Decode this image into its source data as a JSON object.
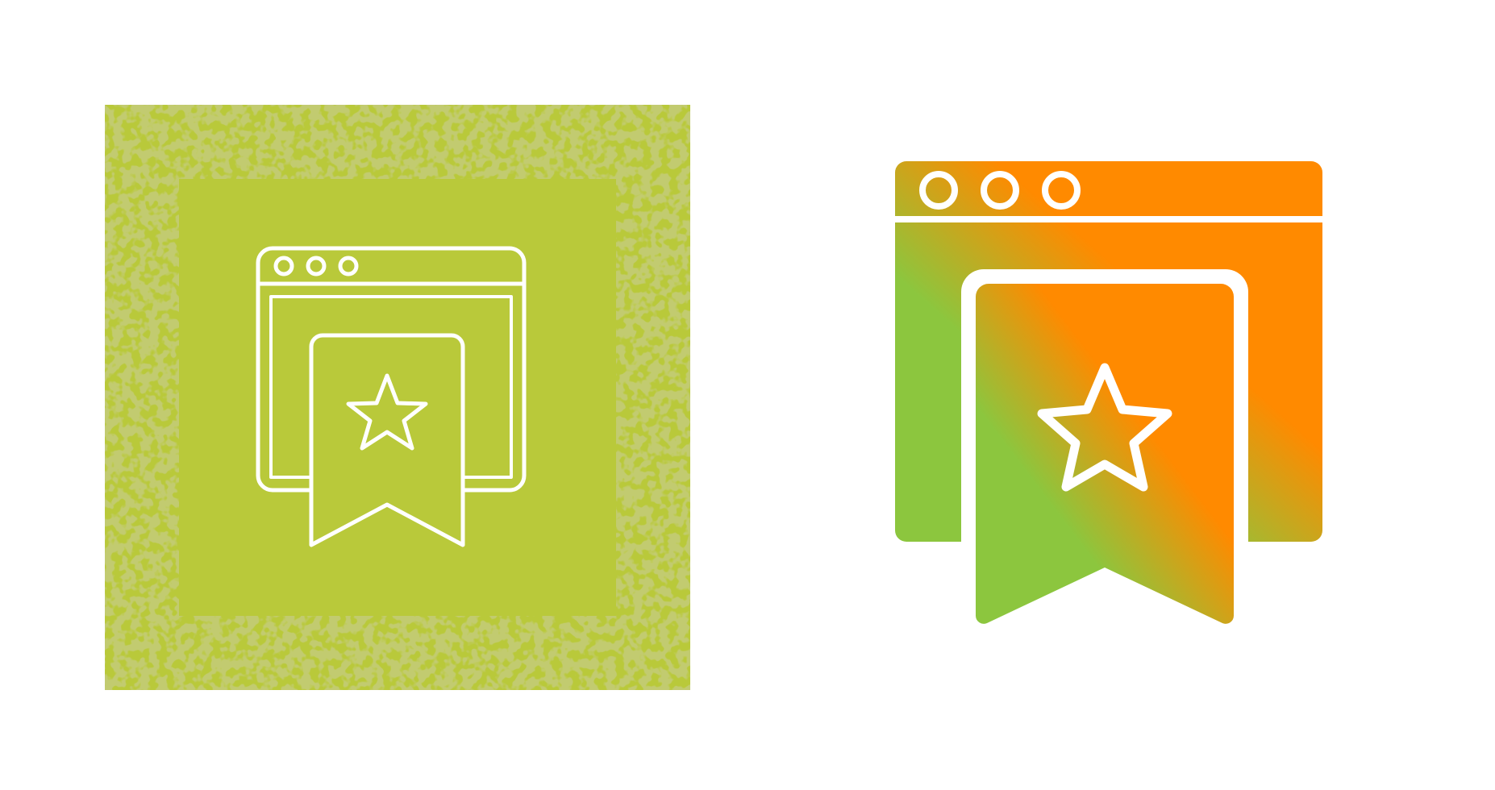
{
  "icons": [
    {
      "name": "bookmark-browser-icon",
      "style": "line",
      "background_color": "#b9c93a",
      "texture_color": "#8a9a2a",
      "stroke_color": "#ffffff"
    },
    {
      "name": "bookmark-browser-icon",
      "style": "gradient",
      "gradient_start": "#8cc63e",
      "gradient_end": "#ff8a00",
      "stroke_color": "#ffffff"
    }
  ]
}
